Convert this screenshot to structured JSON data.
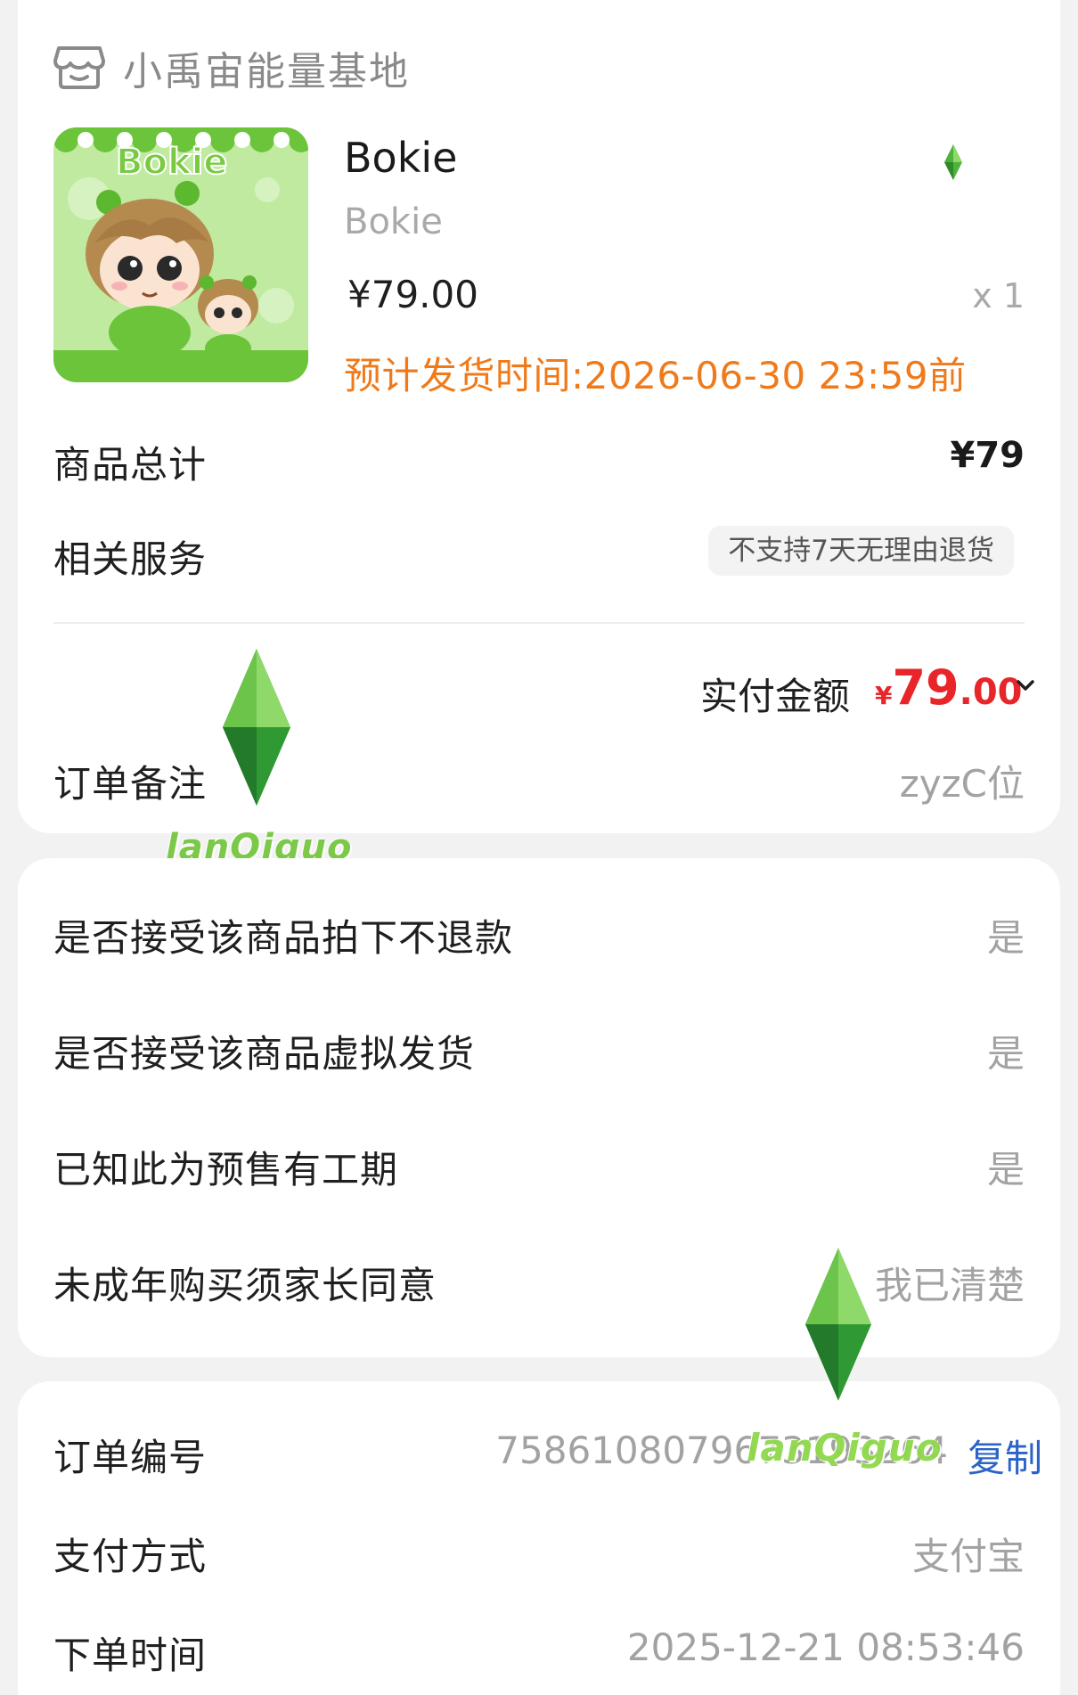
{
  "shop": {
    "name": "小禹宙能量基地",
    "icon": "store-icon"
  },
  "product": {
    "title": "Bokie",
    "subtitle": "Bokie",
    "image_text": "Bokie",
    "price": "¥79.00",
    "quantity": "x 1",
    "ship_time": "预计发货时间:2026-06-30 23:59前"
  },
  "summary": {
    "total_label": "商品总计",
    "total_value": "¥79",
    "service_label": "相关服务",
    "service_badge": "不支持7天无理由退货",
    "paid_label": "实付金额",
    "paid_currency": "¥",
    "paid_int": "79",
    "paid_dec": ".00",
    "remark_label": "订单备注",
    "remark_value": "zyzC位"
  },
  "questions": [
    {
      "label": "是否接受该商品拍下不退款",
      "value": "是"
    },
    {
      "label": "是否接受该商品虚拟发货",
      "value": "是"
    },
    {
      "label": "已知此为预售有工期",
      "value": "是"
    },
    {
      "label": "未成年购买须家长同意",
      "value": "我已清楚"
    }
  ],
  "order": {
    "number_label": "订单编号",
    "number_value": "7586108079673193264",
    "copy_label": "复制",
    "pay_label": "支付方式",
    "pay_value": "支付宝",
    "time_label": "下单时间",
    "time_value": "2025-12-21 08:53:46"
  },
  "watermark": {
    "text": "lanQiguo"
  },
  "colors": {
    "accent_orange": "#f07a1a",
    "price_red": "#e8262a",
    "link_blue": "#2b63c9",
    "watermark_green": "#7cc94a"
  }
}
